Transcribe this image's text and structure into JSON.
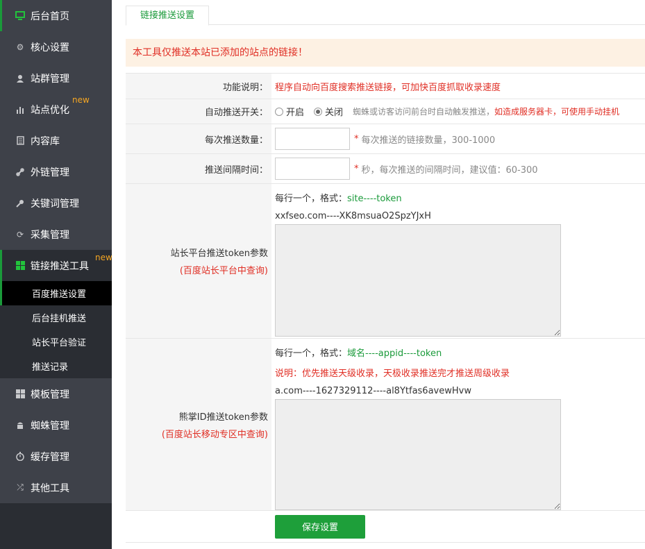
{
  "sidebar": {
    "items": [
      {
        "label": "后台首页",
        "icon": "monitor-icon"
      },
      {
        "label": "核心设置",
        "icon": "gear-icon"
      },
      {
        "label": "站群管理",
        "icon": "user-icon"
      },
      {
        "label": "站点优化",
        "icon": "bar-chart-icon",
        "badge": "new"
      },
      {
        "label": "内容库",
        "icon": "document-icon"
      },
      {
        "label": "外链管理",
        "icon": "link-icon"
      },
      {
        "label": "关键词管理",
        "icon": "key-icon"
      },
      {
        "label": "采集管理",
        "icon": "refresh-icon"
      },
      {
        "label": "链接推送工具",
        "icon": "windows-icon",
        "badge": "new"
      },
      {
        "label": "模板管理",
        "icon": "windows-icon"
      },
      {
        "label": "蜘蛛管理",
        "icon": "android-icon"
      },
      {
        "label": "缓存管理",
        "icon": "stopwatch-icon"
      },
      {
        "label": "其他工具",
        "icon": "shuffle-icon"
      }
    ],
    "subitems": [
      "百度推送设置",
      "后台挂机推送",
      "站长平台验证",
      "推送记录"
    ]
  },
  "tab": {
    "label": "链接推送设置"
  },
  "notice": "本工具仅推送本站已添加的站点的链接！",
  "form": {
    "desc_label": "功能说明：",
    "desc_value": "程序自动向百度搜索推送链接，可加快百度抓取收录速度",
    "auto_label": "自动推送开关：",
    "radio_on": "开启",
    "radio_off": "关闭",
    "auto_hint_gray": "蜘蛛或访客访问前台时自动触发推送，",
    "auto_hint_red": "如造成服务器卡，可使用手动挂机",
    "count_label": "每次推送数量：",
    "count_value": "",
    "count_hint": "每次推送的链接数量，300-1000",
    "interval_label": "推送间隔时间：",
    "interval_value": "",
    "interval_hint": "秒，每次推送的间隔时间，建议值：60-300",
    "token_label": "站长平台推送token参数",
    "token_sub": "(百度站长平台中查询)",
    "token_format_prefix": "每行一个，格式：",
    "token_format": "site----token",
    "token_example": "xxfseo.com----XK8msuaO2SpzYJxH",
    "xzh_label": "熊掌ID推送token参数",
    "xzh_sub": "(百度站长移动专区中查询)",
    "xzh_format_prefix": "每行一个，格式：",
    "xzh_format": "域名----appid----token",
    "xzh_note": "说明：优先推送天级收录，天极收录推送完才推送周级收录",
    "xzh_example": "a.com----1627329112----al8Ytfas6avewHvw",
    "save_label": "保存设置"
  },
  "colors": {
    "accent": "#1a9a3a",
    "warning": "#e02e24",
    "badge": "#f5a623",
    "sidebar_bg": "#3e4149"
  }
}
